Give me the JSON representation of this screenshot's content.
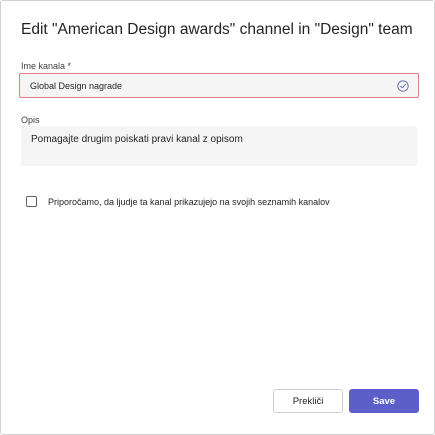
{
  "dialog": {
    "title": "Edit \"American Design awards\" channel in \"Design\" team"
  },
  "name_field": {
    "label": "Ime kanala *",
    "value": "Global Design nagrade",
    "status_icon": "check-circle-icon",
    "border_color": "#e37d80"
  },
  "description_field": {
    "label": "Opis",
    "value": "Pomagajte drugim poiskati pravi kanal z opisom"
  },
  "show_channel_checkbox": {
    "label": "Priporočamo, da ljudje ta kanal prikazujejo na svojih seznamih kanalov",
    "checked": false
  },
  "buttons": {
    "cancel_label": "Prekliči",
    "save_label": "Save"
  },
  "colors": {
    "accent": "#5b5fc7",
    "field_background": "#f5f5f5"
  }
}
